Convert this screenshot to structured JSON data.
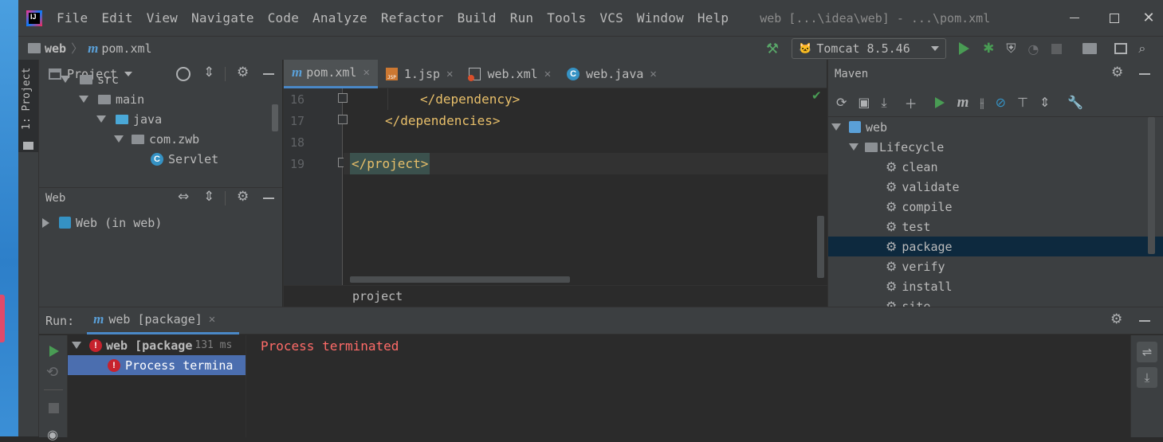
{
  "menubar": {
    "items": [
      "File",
      "Edit",
      "View",
      "Navigate",
      "Code",
      "Analyze",
      "Refactor",
      "Build",
      "Run",
      "Tools",
      "VCS",
      "Window",
      "Help"
    ],
    "window_title": "web [...\\idea\\web] - ...\\pom.xml"
  },
  "navbar": {
    "breadcrumb_project": "web",
    "breadcrumb_file": "pom.xml",
    "run_config": "Tomcat 8.5.46"
  },
  "sidebar_strip": {
    "label": "1: Project"
  },
  "project_panel": {
    "title": "Project",
    "tree": [
      {
        "label": "src",
        "depth": 0
      },
      {
        "label": "main",
        "depth": 1
      },
      {
        "label": "java",
        "depth": 2
      },
      {
        "label": "com.zwb",
        "depth": 3
      },
      {
        "label": "Servlet",
        "depth": 4
      }
    ]
  },
  "web_panel": {
    "title": "Web",
    "item": "Web (in web)"
  },
  "editor": {
    "tabs": [
      {
        "label": "pom.xml",
        "icon": "maven-icon",
        "active": true
      },
      {
        "label": "1.jsp",
        "icon": "jsp-icon",
        "active": false
      },
      {
        "label": "web.xml",
        "icon": "web-xml-icon",
        "active": false
      },
      {
        "label": "web.java",
        "icon": "java-class-icon",
        "active": false
      }
    ],
    "lines": [
      {
        "num": "16",
        "text": "</dependency>"
      },
      {
        "num": "17",
        "text": "</dependencies>"
      },
      {
        "num": "18",
        "text": ""
      },
      {
        "num": "19",
        "text": "</project>"
      }
    ],
    "breadcrumb": "project"
  },
  "maven_panel": {
    "title": "Maven",
    "root": "web",
    "lifecycle": "Lifecycle",
    "goals": [
      "clean",
      "validate",
      "compile",
      "test",
      "package",
      "verify",
      "install",
      "site"
    ],
    "selected": "package"
  },
  "run_panel": {
    "label": "Run:",
    "tab": "web [package]",
    "tree_root": "web [package",
    "tree_time": "131 ms",
    "tree_child": "Process termina",
    "console": "Process terminated"
  },
  "colors": {
    "bg": "#2b2b2b",
    "panel": "#3c3f41",
    "selection": "#0d293e",
    "error": "#ff6b68",
    "tag": "#e8bf6a"
  }
}
